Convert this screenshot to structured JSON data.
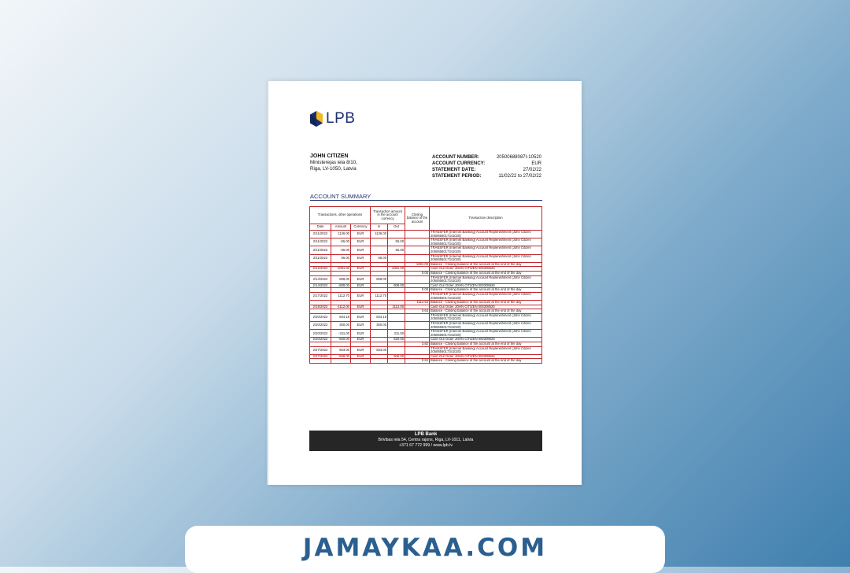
{
  "logo": {
    "text": "LPB",
    "colors": {
      "blue": "#1d2f6f",
      "yellow": "#f2b820"
    }
  },
  "customer": {
    "name": "JOHN CITIZEN",
    "address_line1": "Ministerejas iela 8/10,",
    "address_line2": "Riga, LV-1050, Latvia"
  },
  "account": [
    {
      "label": "ACCOUNT NUMBER:",
      "value": "20500688087I-10520"
    },
    {
      "label": "ACCOUNT CURRENCY:",
      "value": "EUR"
    },
    {
      "label": "STATEMENT DATE:",
      "value": "27/02/22"
    },
    {
      "label": "STATEMENT PERIOD:",
      "value": "11/02/22 to 27/02/22"
    }
  ],
  "summary_title": "ACCOUNT SUMMARY",
  "table": {
    "group_ops": "Transactions, other operations",
    "group_amount": "Transaction amount in the account currency",
    "group_closing": "Closing balance of the account",
    "group_desc": "Transaction description",
    "col_date": "Date",
    "col_amount": "Amount",
    "col_currency": "Currency",
    "col_in": "In",
    "col_out": "Out",
    "rows": [
      {
        "date": "2/11/2022",
        "amount": "1136.00",
        "currency": "EUR",
        "in": "1136.00",
        "out": "",
        "closing": "",
        "desc": "TRANSFER (Internet Banking) Account Replenishment (John Citizen 2050656017341020)"
      },
      {
        "date": "2/11/2022",
        "amount": "-55.00",
        "currency": "EUR",
        "in": "",
        "out": "55.00",
        "closing": "",
        "desc": "TRANSFER (Internet Banking) Account Replenishment (John Citizen 2050656017341020)"
      },
      {
        "date": "2/11/2022",
        "amount": "-55.00",
        "currency": "EUR",
        "in": "",
        "out": "55.00",
        "closing": "",
        "desc": "TRANSFER (Internet Banking) Account Replenishment (John Citizen 2050656017341020)"
      },
      {
        "date": "2/11/2022",
        "amount": "55.00",
        "currency": "EUR",
        "in": "55.00",
        "out": "",
        "closing": "",
        "desc": "TRANSFER (Internet Banking) Account Replenishment (John Citizen 2050656017341020)"
      },
      {
        "date": "",
        "amount": "",
        "currency": "",
        "in": "",
        "out": "",
        "closing": "1081.00",
        "desc": "Balance - Closing balance of the account at the end of the day"
      },
      {
        "date": "2/12/2022",
        "amount": "-1081.00",
        "currency": "EUR",
        "in": "",
        "out": "1081.00",
        "closing": "",
        "desc": "Cash Out Order JOHN CITIZEN 000308526"
      },
      {
        "date": "",
        "amount": "",
        "currency": "",
        "in": "",
        "out": "",
        "closing": "0.00",
        "desc": "Balance - Closing balance of the account at the end of the day"
      },
      {
        "date": "2/14/2022",
        "amount": "808.00",
        "currency": "EUR",
        "in": "808.00",
        "out": "",
        "closing": "",
        "desc": "TRANSFER (Internet Banking) Account Replenishment (John Citizen 2050656017341020)"
      },
      {
        "date": "2/14/2022",
        "amount": "-808.00",
        "currency": "EUR",
        "in": "",
        "out": "808.00",
        "closing": "",
        "desc": "Cash Out Order JOHN CITIZEN 000308526"
      },
      {
        "date": "",
        "amount": "",
        "currency": "",
        "in": "",
        "out": "",
        "closing": "0.00",
        "desc": "Balance - Closing balance of the account at the end of the day"
      },
      {
        "date": "2/17/2022",
        "amount": "1112.70",
        "currency": "EUR",
        "in": "1112.70",
        "out": "",
        "closing": "",
        "desc": "TRANSFER (Internet Banking) Account Replenishment (John Citizen 2050656017341020)"
      },
      {
        "date": "",
        "amount": "",
        "currency": "",
        "in": "",
        "out": "",
        "closing": "1112.64",
        "desc": "Balance - Closing balance of the account at the end of the day"
      },
      {
        "date": "2/18/2022",
        "amount": "-1112.00",
        "currency": "EUR",
        "in": "",
        "out": "1112.00",
        "closing": "",
        "desc": "Cash Out Order JOHN CITIZEN 000308526"
      },
      {
        "date": "",
        "amount": "",
        "currency": "",
        "in": "",
        "out": "",
        "closing": "0.64",
        "desc": "Balance - Closing balance of the account at the end of the day"
      },
      {
        "date": "2/20/2022",
        "amount": "834.18",
        "currency": "EUR",
        "in": "834.18",
        "out": "",
        "closing": "",
        "desc": "TRANSFER (Internet Banking) Account Replenishment (John Citizen 2050656017341020)"
      },
      {
        "date": "2/20/2022",
        "amount": "300.00",
        "currency": "EUR",
        "in": "300.00",
        "out": "",
        "closing": "",
        "desc": "TRANSFER (Internet Banking) Account Replenishment (John Citizen 2050656017341020)"
      },
      {
        "date": "2/20/2022",
        "amount": "-311.00",
        "currency": "EUR",
        "in": "",
        "out": "311.00",
        "closing": "",
        "desc": "TRANSFER (Internet Banking) Account Replenishment (John Citizen 2050656017341020)"
      },
      {
        "date": "2/20/2022",
        "amount": "-820.00",
        "currency": "EUR",
        "in": "",
        "out": "820.00",
        "closing": "",
        "desc": "Cash Out Order JOHN CITIZEN 000308526"
      },
      {
        "date": "",
        "amount": "",
        "currency": "",
        "in": "",
        "out": "",
        "closing": "3.82",
        "desc": "Balance - Closing balance of the account at the end of the day"
      },
      {
        "date": "2/27/2022",
        "amount": "503.00",
        "currency": "EUR",
        "in": "503.00",
        "out": "",
        "closing": "",
        "desc": "TRANSFER (Internet Banking) Account Replenishment (John Citizen 2050656017341020)"
      },
      {
        "date": "2/27/2022",
        "amount": "-506.00",
        "currency": "EUR",
        "in": "",
        "out": "506.00",
        "closing": "",
        "desc": "Cash Out Order JOHN CITIZEN 000308526"
      },
      {
        "date": "",
        "amount": "",
        "currency": "",
        "in": "",
        "out": "",
        "closing": "0.82",
        "desc": "Balance - Closing balance of the account at the end of the day"
      }
    ]
  },
  "footer": {
    "bank": "LPB Bank",
    "address": "Brivibas iela 54, Centra rajons, Riga, LV-1011, Latvia",
    "contact": "+371 67 772 999 / www.lpb.lv"
  },
  "watermark": "JAMAYKAA.COM"
}
